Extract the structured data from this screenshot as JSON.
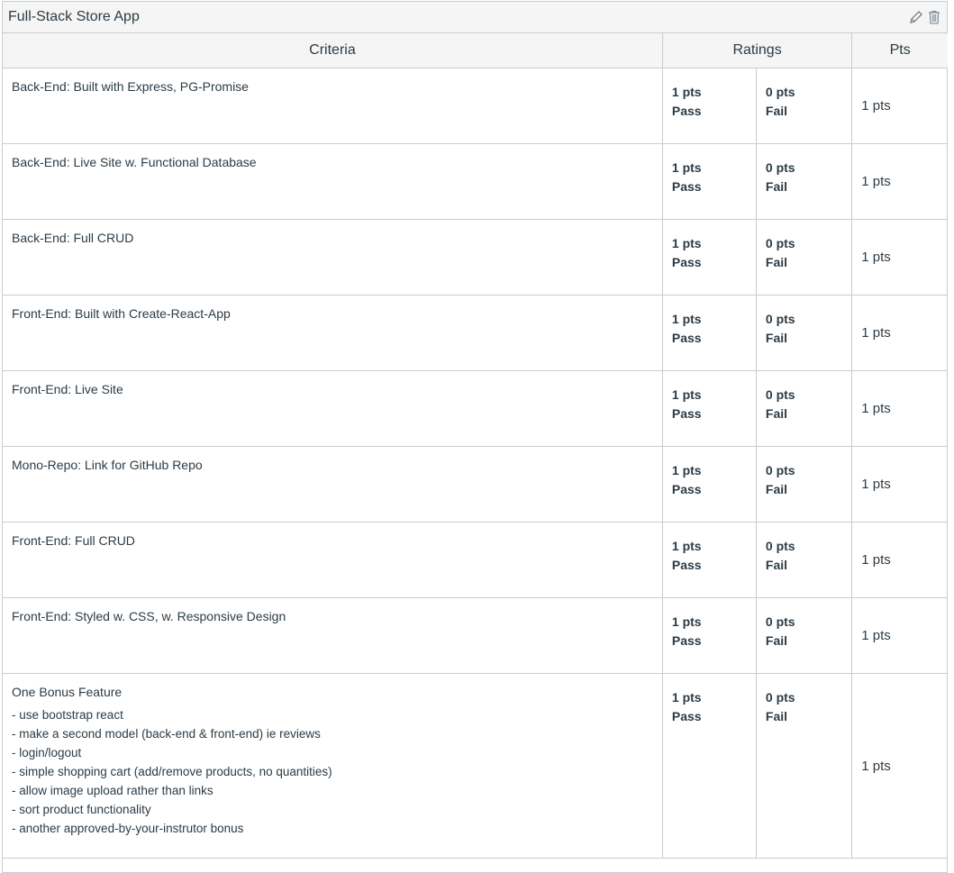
{
  "rubric": {
    "title": "Full-Stack Store App",
    "headers": {
      "criteria": "Criteria",
      "ratings": "Ratings",
      "pts": "Pts"
    },
    "rows": [
      {
        "criterion": "Back-End: Built with Express, PG-Promise",
        "rating_high_pts": "1 pts",
        "rating_high_label": "Pass",
        "rating_low_pts": "0 pts",
        "rating_low_label": "Fail",
        "points": "1 pts"
      },
      {
        "criterion": "Back-End: Live Site w. Functional Database",
        "rating_high_pts": "1 pts",
        "rating_high_label": "Pass",
        "rating_low_pts": "0 pts",
        "rating_low_label": "Fail",
        "points": "1 pts"
      },
      {
        "criterion": "Back-End: Full CRUD",
        "rating_high_pts": "1 pts",
        "rating_high_label": "Pass",
        "rating_low_pts": "0 pts",
        "rating_low_label": "Fail",
        "points": "1 pts"
      },
      {
        "criterion": "Front-End: Built with Create-React-App",
        "rating_high_pts": "1 pts",
        "rating_high_label": "Pass",
        "rating_low_pts": "0 pts",
        "rating_low_label": "Fail",
        "points": "1 pts"
      },
      {
        "criterion": "Front-End: Live Site",
        "rating_high_pts": "1 pts",
        "rating_high_label": "Pass",
        "rating_low_pts": "0 pts",
        "rating_low_label": "Fail",
        "points": "1 pts"
      },
      {
        "criterion": "Mono-Repo: Link for GitHub Repo",
        "rating_high_pts": "1 pts",
        "rating_high_label": "Pass",
        "rating_low_pts": "0 pts",
        "rating_low_label": "Fail",
        "points": "1 pts"
      },
      {
        "criterion": "Front-End: Full CRUD",
        "rating_high_pts": "1 pts",
        "rating_high_label": "Pass",
        "rating_low_pts": "0 pts",
        "rating_low_label": "Fail",
        "points": "1 pts"
      },
      {
        "criterion": "Front-End: Styled w. CSS, w. Responsive Design",
        "rating_high_pts": "1 pts",
        "rating_high_label": "Pass",
        "rating_low_pts": "0 pts",
        "rating_low_label": "Fail",
        "points": "1 pts"
      }
    ],
    "bonus": {
      "criterion": "One Bonus Feature",
      "details": [
        "- use bootstrap react",
        "- make a second model (back-end & front-end) ie reviews",
        "- login/logout",
        "- simple shopping cart (add/remove products, no quantities)",
        "- allow image upload rather than links",
        "- sort product functionality",
        "- another approved-by-your-instrutor bonus"
      ],
      "rating_high_pts": "1 pts",
      "rating_high_label": "Pass",
      "rating_low_pts": "0 pts",
      "rating_low_label": "Fail",
      "points": "1 pts"
    },
    "icons": {
      "edit": "pencil-icon",
      "delete": "trash-icon"
    }
  }
}
